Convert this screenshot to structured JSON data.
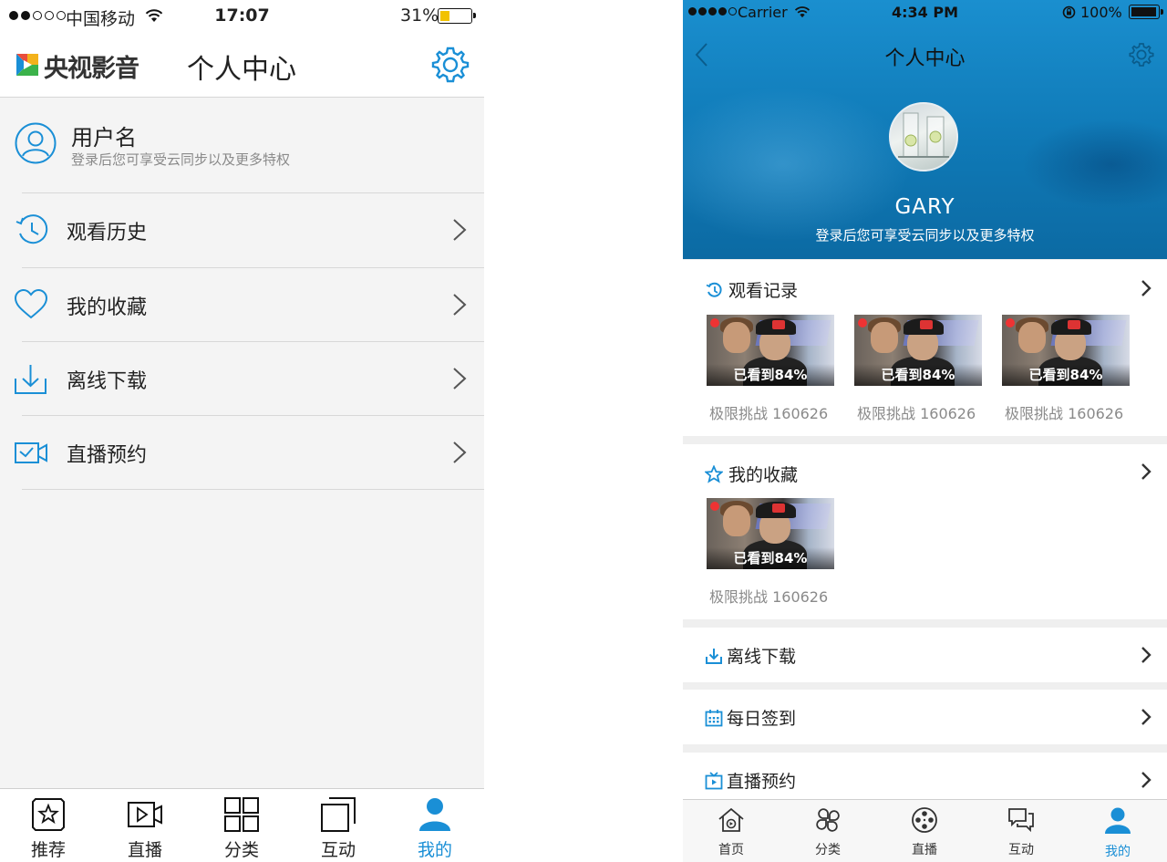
{
  "colors": {
    "accent": "#1a8fd6",
    "battery_fill": "#f2c200",
    "header_blue": "#1183c2",
    "muted": "#8a8a8a"
  },
  "left": {
    "status_bar": {
      "carrier": "中国移动",
      "time": "17:07",
      "battery": "31%",
      "battery_level": 0.31
    },
    "nav": {
      "logo_text": "央视影音",
      "title": "个人中心",
      "settings_icon": "gear-icon"
    },
    "user": {
      "name": "用户名",
      "subtitle": "登录后您可享受云同步以及更多特权",
      "icon": "user-circle-icon"
    },
    "menu": [
      {
        "label": "观看历史",
        "icon": "clock-history-icon"
      },
      {
        "label": "我的收藏",
        "icon": "heart-icon"
      },
      {
        "label": "离线下载",
        "icon": "download-icon"
      },
      {
        "label": "直播预约",
        "icon": "video-camera-icon"
      }
    ],
    "tabs": [
      {
        "label": "推荐",
        "icon": "star-box-icon",
        "active": false
      },
      {
        "label": "直播",
        "icon": "play-camera-icon",
        "active": false
      },
      {
        "label": "分类",
        "icon": "grid-icon",
        "active": false
      },
      {
        "label": "互动",
        "icon": "stacked-squares-icon",
        "active": false
      },
      {
        "label": "我的",
        "icon": "user-icon",
        "active": true
      }
    ]
  },
  "right": {
    "status_bar": {
      "carrier": "Carrier",
      "time": "4:34 PM",
      "battery": "100%",
      "battery_level": 1.0
    },
    "header": {
      "title": "个人中心",
      "username": "GARY",
      "subtitle": "登录后您可享受云同步以及更多特权"
    },
    "history": {
      "title": "观看记录",
      "items": [
        {
          "progress": "已看到84%",
          "caption": "极限挑战 160626"
        },
        {
          "progress": "已看到84%",
          "caption": "极限挑战 160626"
        },
        {
          "progress": "已看到84%",
          "caption": "极限挑战 160626"
        }
      ]
    },
    "favorites": {
      "title": "我的收藏",
      "items": [
        {
          "progress": "已看到84%",
          "caption": "极限挑战 160626"
        }
      ]
    },
    "rows": [
      {
        "label": "离线下载",
        "icon": "download-icon"
      },
      {
        "label": "每日签到",
        "icon": "calendar-icon"
      },
      {
        "label": "直播预约",
        "icon": "tv-icon"
      }
    ],
    "tabs": [
      {
        "label": "首页",
        "icon": "home-icon",
        "active": false
      },
      {
        "label": "分类",
        "icon": "clover-icon",
        "active": false
      },
      {
        "label": "直播",
        "icon": "film-reel-icon",
        "active": false
      },
      {
        "label": "互动",
        "icon": "chat-icon",
        "active": false
      },
      {
        "label": "我的",
        "icon": "user-icon",
        "active": true
      }
    ]
  }
}
